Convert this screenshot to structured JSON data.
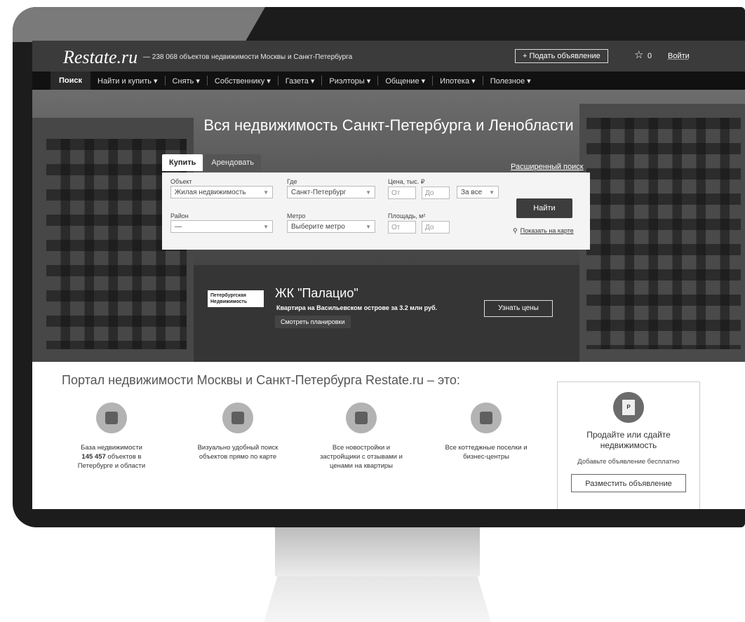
{
  "header": {
    "logo": "Restate.ru",
    "tagline": "— 238 068 объектов недвижимости Москвы и Санкт-Петербурга",
    "add_listing": "+ Подать объявление",
    "favorites_count": "0",
    "login": "Войти"
  },
  "nav": {
    "items": [
      {
        "label": "Поиск"
      },
      {
        "label": "Найти и купить ▾"
      },
      {
        "label": "Снять ▾"
      },
      {
        "label": "Собственнику ▾"
      },
      {
        "label": "Газета ▾"
      },
      {
        "label": "Риэлторы ▾"
      },
      {
        "label": "Общение ▾"
      },
      {
        "label": "Ипотека ▾"
      },
      {
        "label": "Полезное ▾"
      }
    ]
  },
  "hero": {
    "title": "Вся недвижимость Санкт-Петербурга и Ленобласти",
    "tabs": [
      "Купить",
      "Арендовать"
    ],
    "advanced_search": "Расширенный поиск",
    "fields": {
      "object_label": "Объект",
      "object_value": "Жилая недвижимость",
      "where_label": "Где",
      "where_value": "Санкт-Петербург",
      "price_label": "Цена, тыс. ₽",
      "from_placeholder": "От",
      "to_placeholder": "До",
      "price_period": "За все",
      "district_label": "Район",
      "district_value": "—",
      "metro_label": "Метро",
      "metro_value": "Выберите метро",
      "area_label": "Площадь, м²"
    },
    "find_button": "Найти",
    "show_on_map": "Показать на карте"
  },
  "promo": {
    "logo_text_1": "Петербургская",
    "logo_text_2": "Недвижимость",
    "title": "ЖК \"Палацио\"",
    "subtitle": "Квартира на Васильевском острове за 3.2 млн руб.",
    "plans_link": "Смотреть планировки",
    "prices_button": "Узнать цены"
  },
  "portal": {
    "title": "Портал недвижимости Москвы и Санкт-Петербурга Restate.ru – это:",
    "features": [
      {
        "line1": "База недвижимости",
        "bold": "145 457",
        "line2": "объектов в",
        "line3": "Петербурге и области"
      },
      {
        "line1": "Визуально удобный поиск",
        "line2": "объектов прямо по карте"
      },
      {
        "line1": "Все новостройки и",
        "line2": "застройщики с отзывами и",
        "line3": "ценами на квартиры"
      },
      {
        "line1": "Все коттеджные поселки и",
        "line2": "бизнес-центры"
      }
    ],
    "sell_box": {
      "icon_text": "P",
      "title": "Продайте или сдайте недвижимость",
      "subtitle": "Добавьте объявление бесплатно",
      "button": "Разместить объявление"
    }
  }
}
